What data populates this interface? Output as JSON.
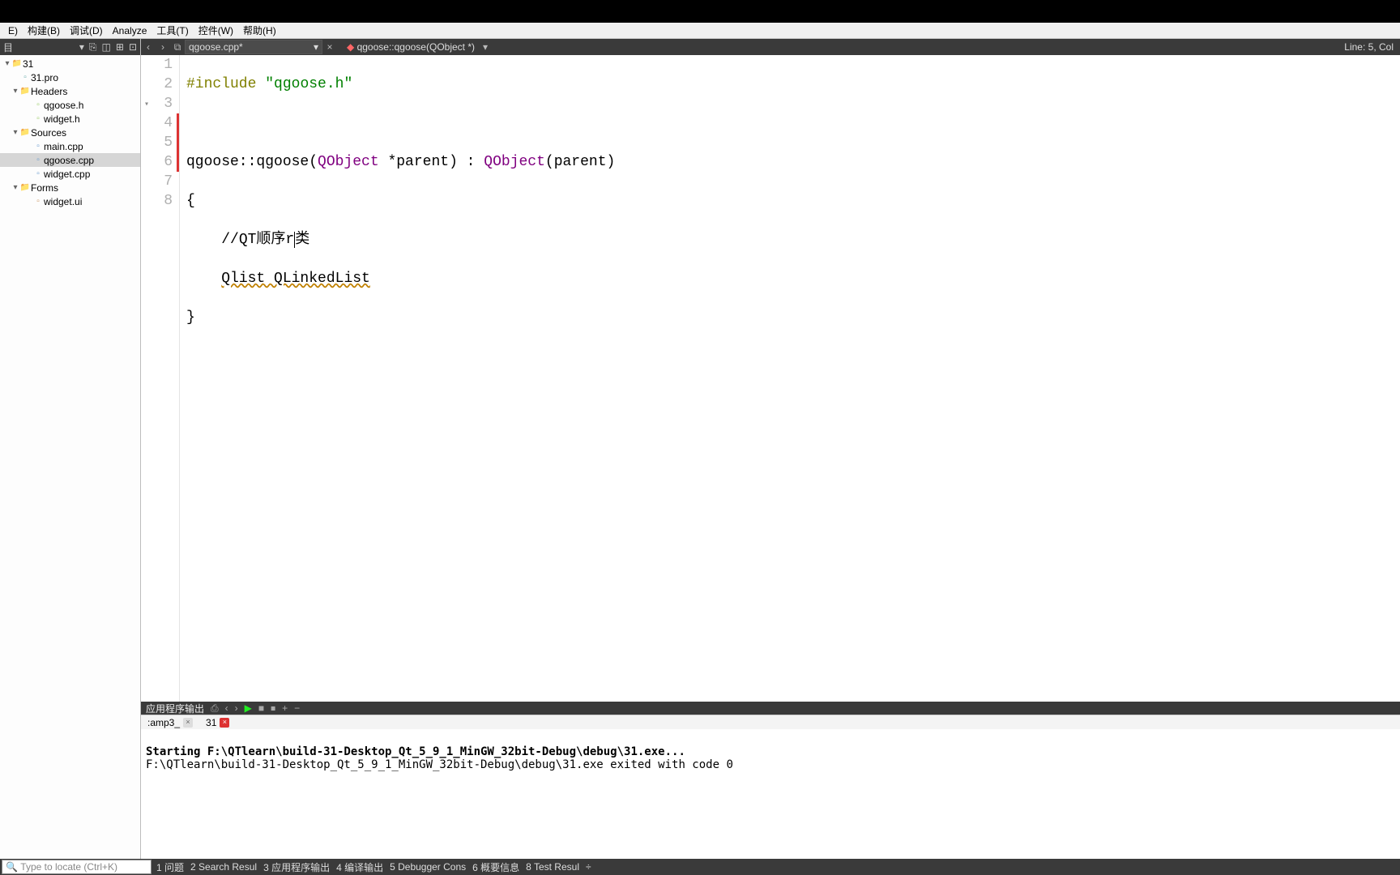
{
  "menu": {
    "file_trunc": "E)",
    "build": "构建(B)",
    "debug": "调试(D)",
    "analyze": "Analyze",
    "tools": "工具(T)",
    "controls": "控件(W)",
    "help": "帮助(H)"
  },
  "toolbar": {
    "back": "‹",
    "fwd": "›",
    "file_icon": "⧉",
    "current_file": "qgoose.cpp*",
    "file_chev": "▾",
    "close": "×",
    "sym_icon": "◆",
    "symbol": "qgoose::qgoose(QObject *)",
    "sym_chev": "▾",
    "cursor": "Line: 5, Col"
  },
  "sidebar_tools": {
    "a": "目",
    "b": "▾",
    "c": "⎘",
    "d": "⌕",
    "e": "◫",
    "f": "⊞",
    "g": "⊡"
  },
  "tree": {
    "proj": "31",
    "profile": "31.pro",
    "headers": "Headers",
    "h1": "qgoose.h",
    "h2": "widget.h",
    "sources": "Sources",
    "s1": "main.cpp",
    "s2": "qgoose.cpp",
    "s3": "widget.cpp",
    "forms": "Forms",
    "f1": "widget.ui"
  },
  "code": {
    "l1_include": "#include",
    "l1_str": "\"qgoose.h\"",
    "l3_a": "qgoose::qgoose(",
    "l3_qobj": "QObject",
    "l3_b": " *parent) : ",
    "l3_qobj2": "QObject",
    "l3_c": "(parent)",
    "l4": "{",
    "l5_slash": "//QT顺序r",
    "l5_tail": "类",
    "l6": "Qlist QLinkedList",
    "l7": "}"
  },
  "lines": {
    "1": "1",
    "2": "2",
    "3": "3",
    "4": "4",
    "5": "5",
    "6": "6",
    "7": "7",
    "8": "8"
  },
  "out_header": {
    "title": "应用程序输出",
    "a": "⎙",
    "prev": "‹",
    "next": "›",
    "play": "▶",
    "stop": "■",
    "stop2": "⏹",
    "add": "+",
    "minus": "−"
  },
  "out_tabs": {
    "t1": ":amp3_",
    "t2": "31"
  },
  "output": {
    "l1": "Starting F:\\QTlearn\\build-31-Desktop_Qt_5_9_1_MinGW_32bit-Debug\\debug\\31.exe...",
    "l2": "F:\\QTlearn\\build-31-Desktop_Qt_5_9_1_MinGW_32bit-Debug\\debug\\31.exe exited with code 0"
  },
  "locator": {
    "icon": "🔍",
    "placeholder": "Type to locate (Ctrl+K)"
  },
  "status": {
    "s1": "1 问题",
    "s2": "2 Search Resul",
    "s3": "3 应用程序输出",
    "s4": "4 编译输出",
    "s5": "5 Debugger Cons",
    "s6": "6 概要信息",
    "s7": "8 Test Resul",
    "more": "÷"
  }
}
